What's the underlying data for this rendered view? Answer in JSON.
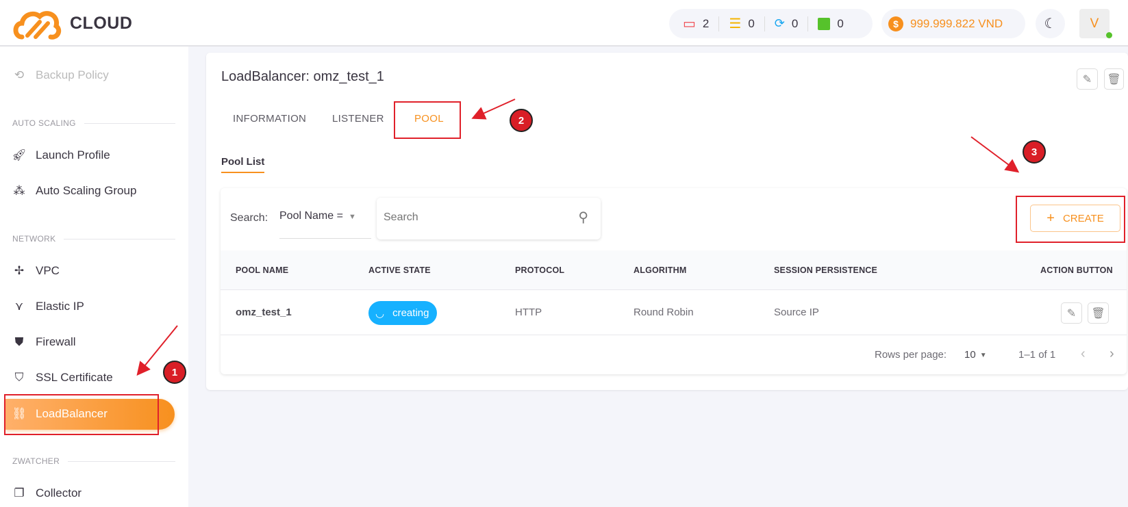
{
  "brand": {
    "name": "CLOUD",
    "color": "#f7901e"
  },
  "header": {
    "stats": [
      {
        "icon": "laptop-icon",
        "value": "2",
        "color": "#f0444a"
      },
      {
        "icon": "server-icon",
        "value": "0",
        "color": "#f5b400"
      },
      {
        "icon": "cloud-sync-icon",
        "value": "0",
        "color": "#1aa7f0"
      },
      {
        "icon": "chart-icon",
        "value": "0",
        "color": "#56c22b"
      }
    ],
    "balance": "999.999.822 VND",
    "avatar": "V"
  },
  "sidebar": {
    "backup": "Backup Policy",
    "sections": [
      "AUTO SCALING",
      "NETWORK",
      "ZWATCHER"
    ],
    "items": [
      "Launch Profile",
      "Auto Scaling Group",
      "VPC",
      "Elastic IP",
      "Firewall",
      "SSL Certificate",
      "LoadBalancer",
      "Collector"
    ]
  },
  "main": {
    "title": "LoadBalancer: omz_test_1",
    "tabs": [
      "INFORMATION",
      "LISTENER",
      "POOL"
    ],
    "active_tab": "POOL",
    "subtab": "Pool List",
    "search_label": "Search:",
    "search_field": "Pool Name =",
    "search_placeholder": "Search",
    "create": "CREATE",
    "columns": [
      "POOL NAME",
      "ACTIVE STATE",
      "PROTOCOL",
      "ALGORITHM",
      "SESSION PERSISTENCE",
      "ACTION BUTTON"
    ],
    "rows": [
      {
        "name": "omz_test_1",
        "state": "creating",
        "protocol": "HTTP",
        "algorithm": "Round Robin",
        "session": "Source IP"
      }
    ],
    "pagination": {
      "rows_label": "Rows per page:",
      "rows_value": "10",
      "range": "1–1 of 1"
    }
  },
  "annotations": [
    "1",
    "2",
    "3"
  ]
}
